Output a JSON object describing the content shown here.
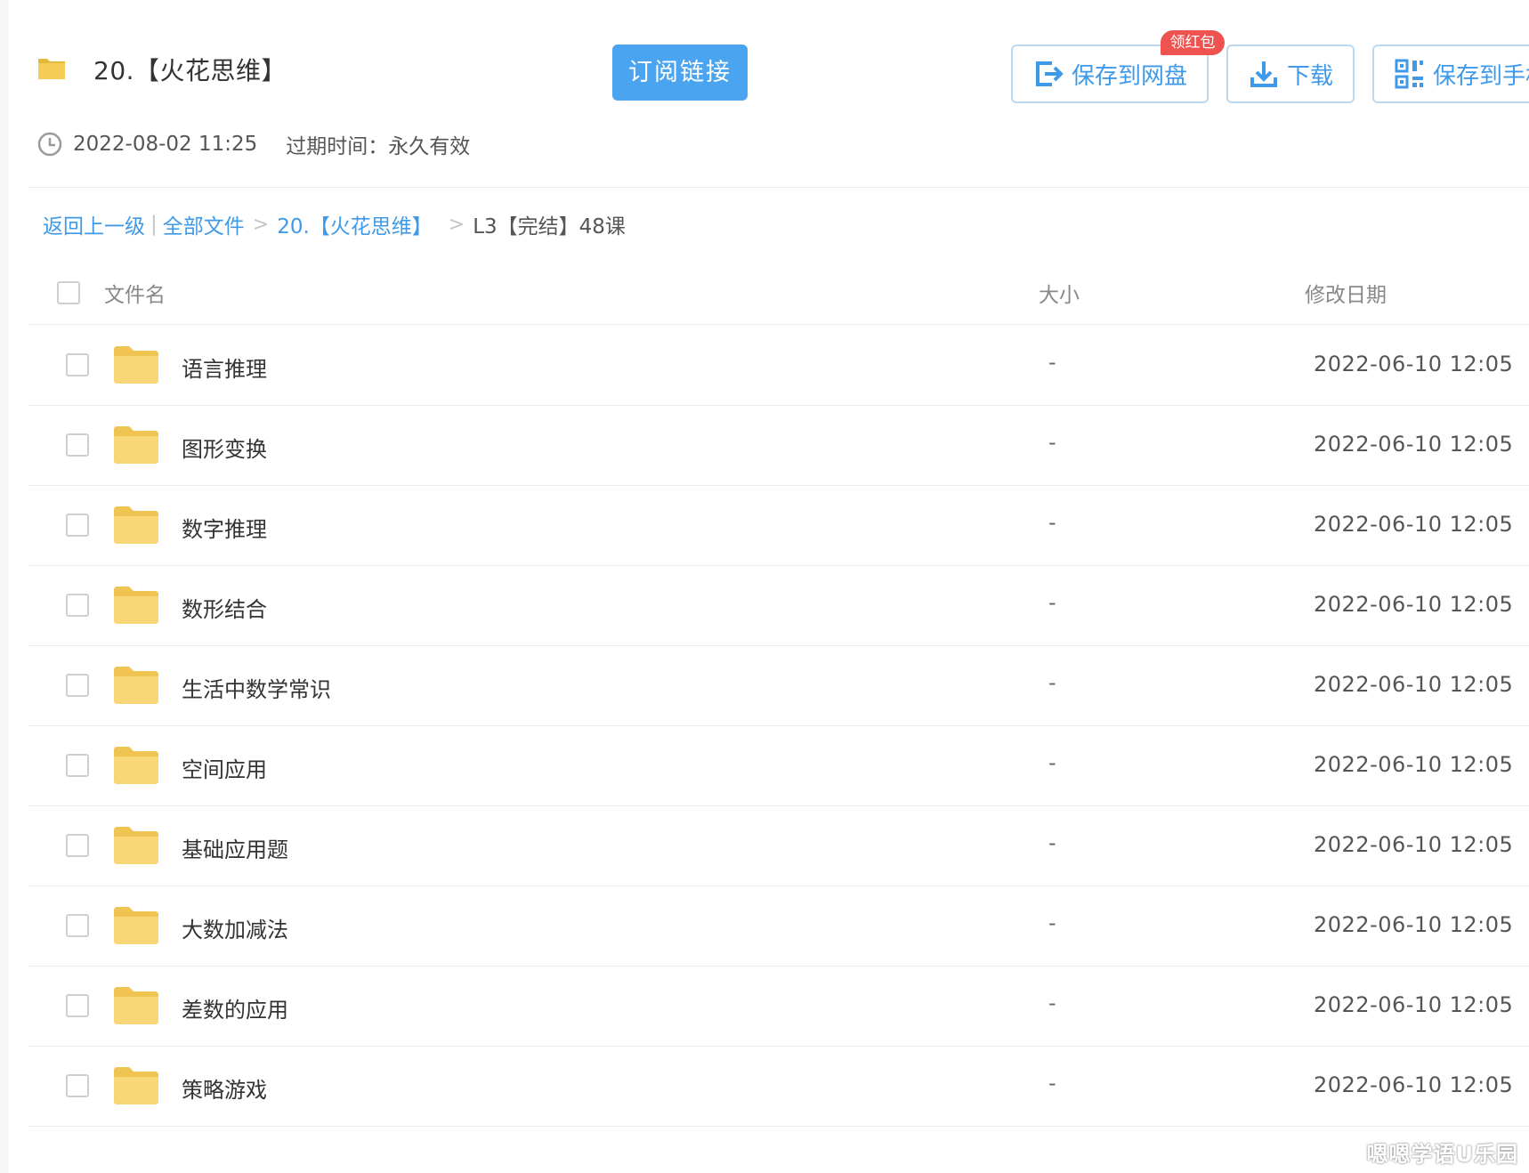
{
  "header": {
    "title": "20.【火花思维】",
    "subscribe_label": "订阅链接",
    "save_to_disk_label": "保存到网盘",
    "badge_label": "领红包",
    "download_label": "下载",
    "save_to_phone_label": "保存到手机"
  },
  "meta": {
    "share_time": "2022-08-02 11:25",
    "expire_label": "过期时间：",
    "expire_value": "永久有效"
  },
  "breadcrumb": {
    "back": "返回上一级",
    "all_files": "全部文件",
    "parent": "20.【火花思维】",
    "sep": ">",
    "bar": "|",
    "current": "L3【完结】48课"
  },
  "table": {
    "col_name": "文件名",
    "col_size": "大小",
    "col_date": "修改日期",
    "rows": [
      {
        "name": "语言推理",
        "size": "-",
        "date": "2022-06-10 12:05"
      },
      {
        "name": "图形变换",
        "size": "-",
        "date": "2022-06-10 12:05"
      },
      {
        "name": "数字推理",
        "size": "-",
        "date": "2022-06-10 12:05"
      },
      {
        "name": "数形结合",
        "size": "-",
        "date": "2022-06-10 12:05"
      },
      {
        "name": "生活中数学常识",
        "size": "-",
        "date": "2022-06-10 12:05"
      },
      {
        "name": "空间应用",
        "size": "-",
        "date": "2022-06-10 12:05"
      },
      {
        "name": "基础应用题",
        "size": "-",
        "date": "2022-06-10 12:05"
      },
      {
        "name": "大数加减法",
        "size": "-",
        "date": "2022-06-10 12:05"
      },
      {
        "name": "差数的应用",
        "size": "-",
        "date": "2022-06-10 12:05"
      },
      {
        "name": "策略游戏",
        "size": "-",
        "date": "2022-06-10 12:05"
      }
    ]
  },
  "watermark": "嗯嗯学语U乐园",
  "colors": {
    "accent": "#4aa4f0",
    "link": "#3e9ae8",
    "badge": "#ef5350",
    "folder": "#f9d776"
  }
}
